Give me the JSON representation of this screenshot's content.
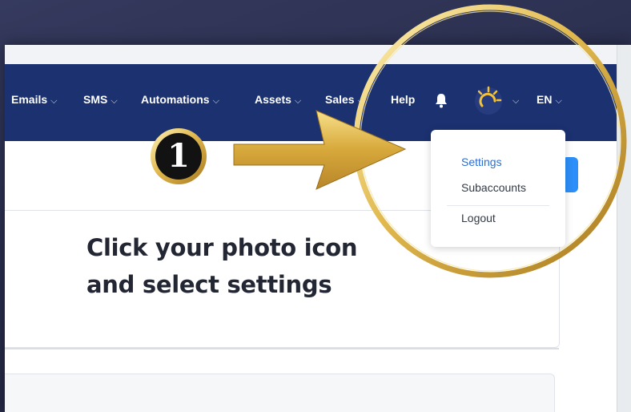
{
  "navbar": {
    "items": [
      {
        "label": "Emails",
        "has_dropdown": true
      },
      {
        "label": "SMS",
        "has_dropdown": true
      },
      {
        "label": "Automations",
        "has_dropdown": true
      },
      {
        "label": "Assets",
        "has_dropdown": true
      },
      {
        "label": "Sales",
        "has_dropdown": true
      },
      {
        "label": "Help",
        "has_dropdown": false
      }
    ],
    "chevron": "⌵",
    "language": "EN",
    "icons": [
      "bell-icon",
      "avatar-sun-icon"
    ]
  },
  "dropdown": {
    "items": [
      {
        "label": "Settings",
        "active": true
      },
      {
        "label": "Subaccounts",
        "active": false
      },
      {
        "label": "Logout",
        "active": false
      }
    ]
  },
  "tutorial": {
    "step_number": "1",
    "instruction": "Click your photo icon and select settings",
    "icons": [
      "arrow-icon",
      "highlight-circle"
    ]
  },
  "colors": {
    "navbar": "#1b3170",
    "accent_blue": "#2c8ef8",
    "gold": "#d9b24a",
    "active_link": "#2a6fd1",
    "background": "#2b2f4f"
  }
}
